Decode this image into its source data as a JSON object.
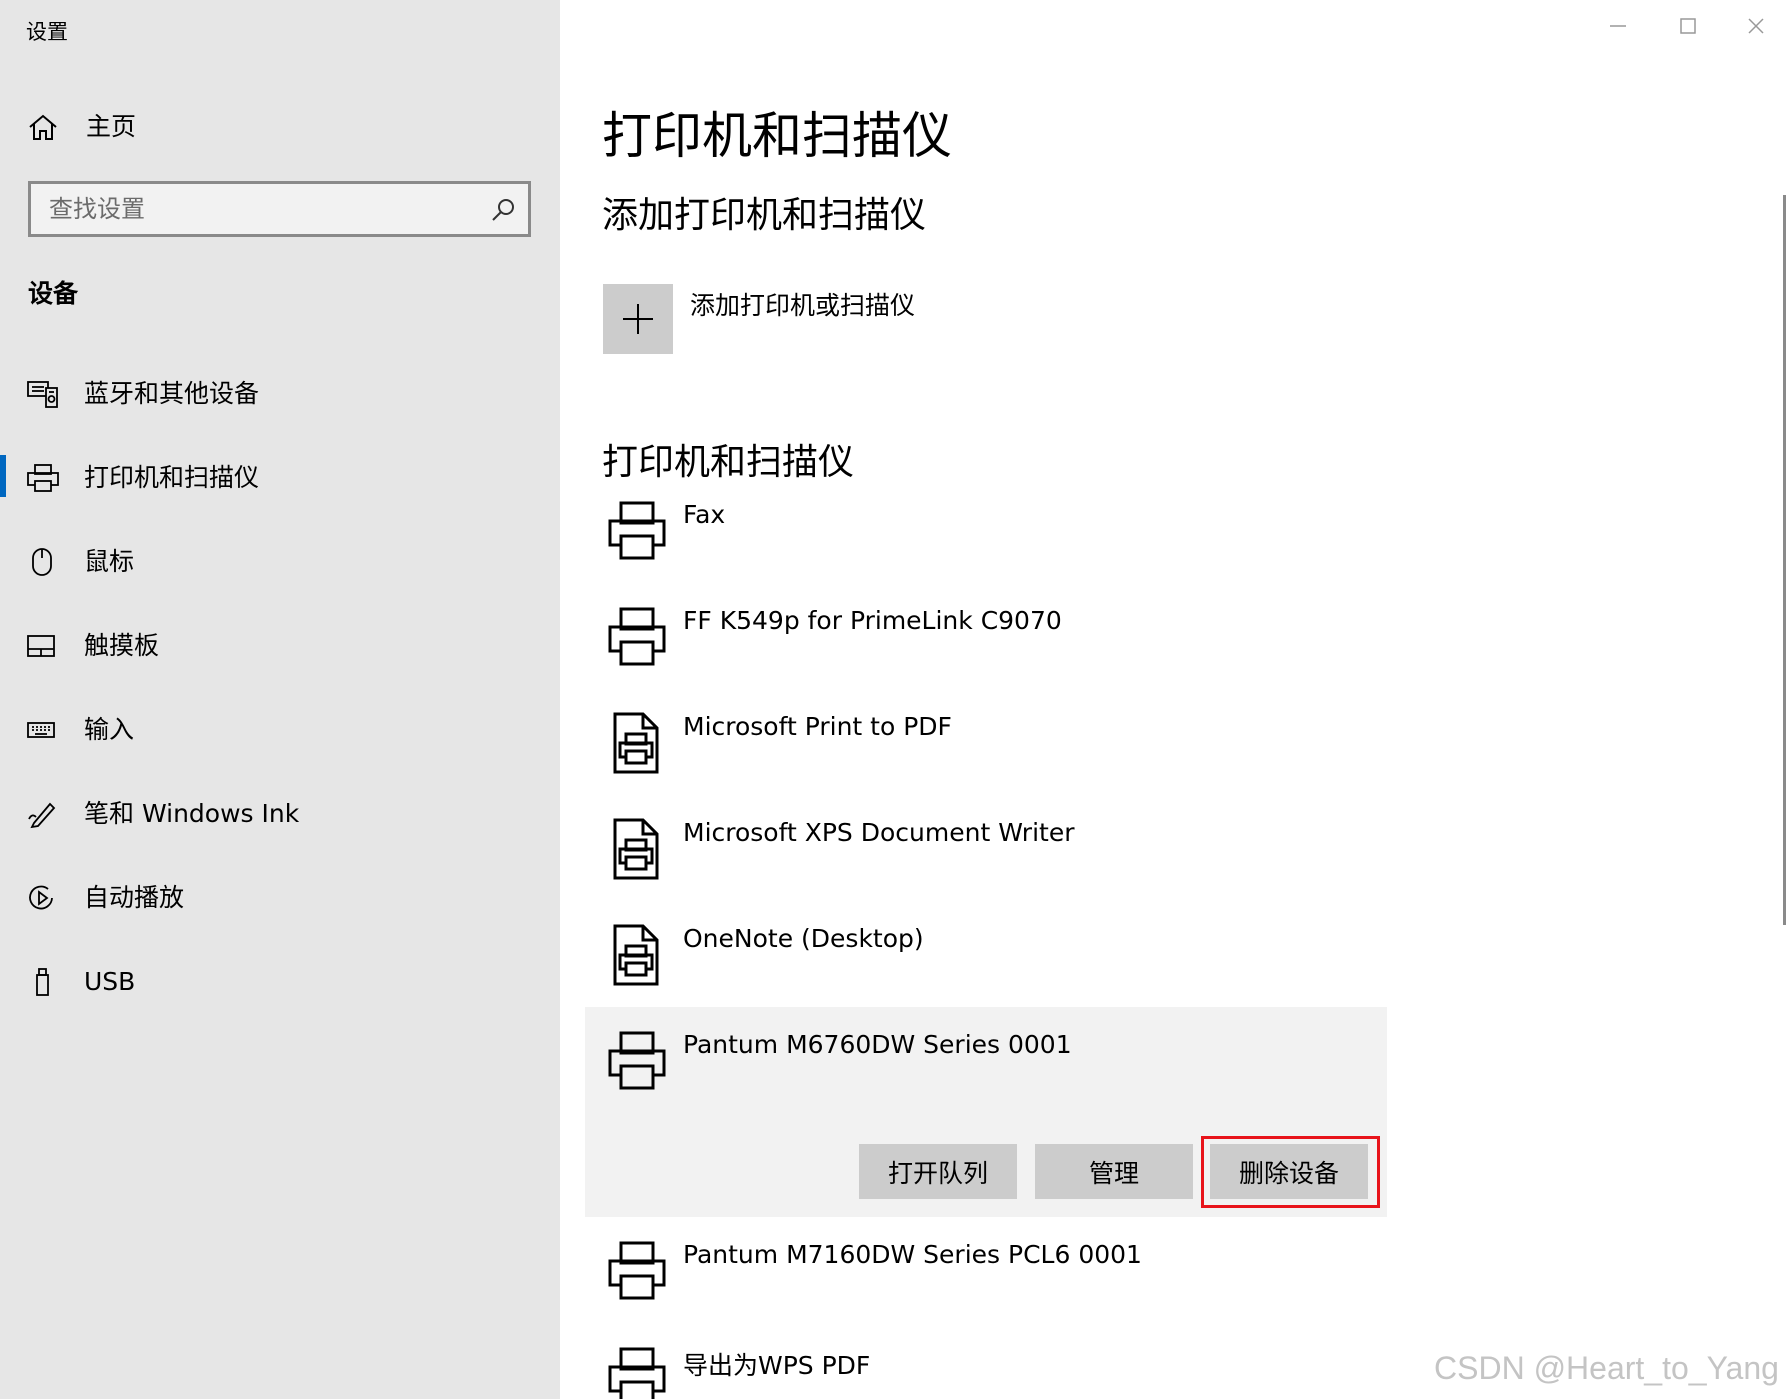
{
  "app": {
    "title": "设置"
  },
  "sidebar": {
    "home_label": "主页",
    "search_placeholder": "查找设置",
    "section_title": "设备",
    "items": [
      {
        "label": "蓝牙和其他设备",
        "icon": "bluetooth-devices-icon"
      },
      {
        "label": "打印机和扫描仪",
        "icon": "printer-icon",
        "active": true
      },
      {
        "label": "鼠标",
        "icon": "mouse-icon"
      },
      {
        "label": "触摸板",
        "icon": "touchpad-icon"
      },
      {
        "label": "输入",
        "icon": "keyboard-icon"
      },
      {
        "label": "笔和 Windows Ink",
        "icon": "pen-icon"
      },
      {
        "label": "自动播放",
        "icon": "autoplay-icon"
      },
      {
        "label": "USB",
        "icon": "usb-icon"
      }
    ],
    "accent_color": "#0067c0"
  },
  "main": {
    "page_title": "打印机和扫描仪",
    "add_section_title": "添加打印机和扫描仪",
    "add_label": "添加打印机或扫描仪",
    "list_section_title": "打印机和扫描仪",
    "printers": [
      {
        "name": "Fax",
        "icon": "printer-icon"
      },
      {
        "name": "FF K549p for PrimeLink C9070",
        "icon": "printer-icon"
      },
      {
        "name": "Microsoft Print to PDF",
        "icon": "document-printer-icon"
      },
      {
        "name": "Microsoft XPS Document Writer",
        "icon": "document-printer-icon"
      },
      {
        "name": "OneNote (Desktop)",
        "icon": "document-printer-icon"
      },
      {
        "name": "Pantum M6760DW Series 0001",
        "icon": "printer-icon",
        "selected": true
      },
      {
        "name": "Pantum M7160DW Series PCL6 0001",
        "icon": "printer-icon"
      },
      {
        "name": "导出为WPS PDF",
        "icon": "printer-icon"
      }
    ],
    "actions": {
      "open_queue": "打开队列",
      "manage": "管理",
      "remove": "删除设备"
    },
    "highlight_color": "#e8141b"
  },
  "watermark": "CSDN @Heart_to_Yang"
}
